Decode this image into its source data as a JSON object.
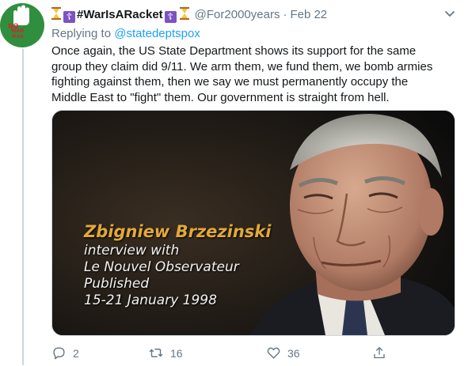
{
  "colors": {
    "link": "#1da1f2",
    "secondary_text": "#657786",
    "avatar_green": "#2f8f3e",
    "caption_gold": "#e2a93a"
  },
  "avatar": {
    "lines": [
      "NO",
      "WAR",
      "IRAN"
    ]
  },
  "tweet": {
    "display_name": "#WarIsARacket",
    "handle": "@For2000years",
    "separator": "·",
    "date": "Feb 22",
    "replying_prefix": "Replying to",
    "replying_handle": "@statedeptspox",
    "text": "Once again, the US State Department shows its support for the same\ngroup they claim did 9/11. We arm them, we fund them, we bomb armies\nfighting against them, then we say we must permanently occupy the\nMiddle East to \"fight\" them. Our government is straight from hell."
  },
  "media": {
    "caption_name": "Zbigniew Brzezinski",
    "caption_lines": [
      "interview with",
      "Le Nouvel Observateur",
      "Published",
      "15-21 January 1998"
    ]
  },
  "actions": {
    "reply_count": "2",
    "retweet_count": "16",
    "like_count": "36"
  },
  "icons": [
    "hourglass-icon",
    "cross-icon",
    "chevron-down-icon",
    "reply-icon",
    "retweet-icon",
    "like-icon",
    "share-icon"
  ]
}
